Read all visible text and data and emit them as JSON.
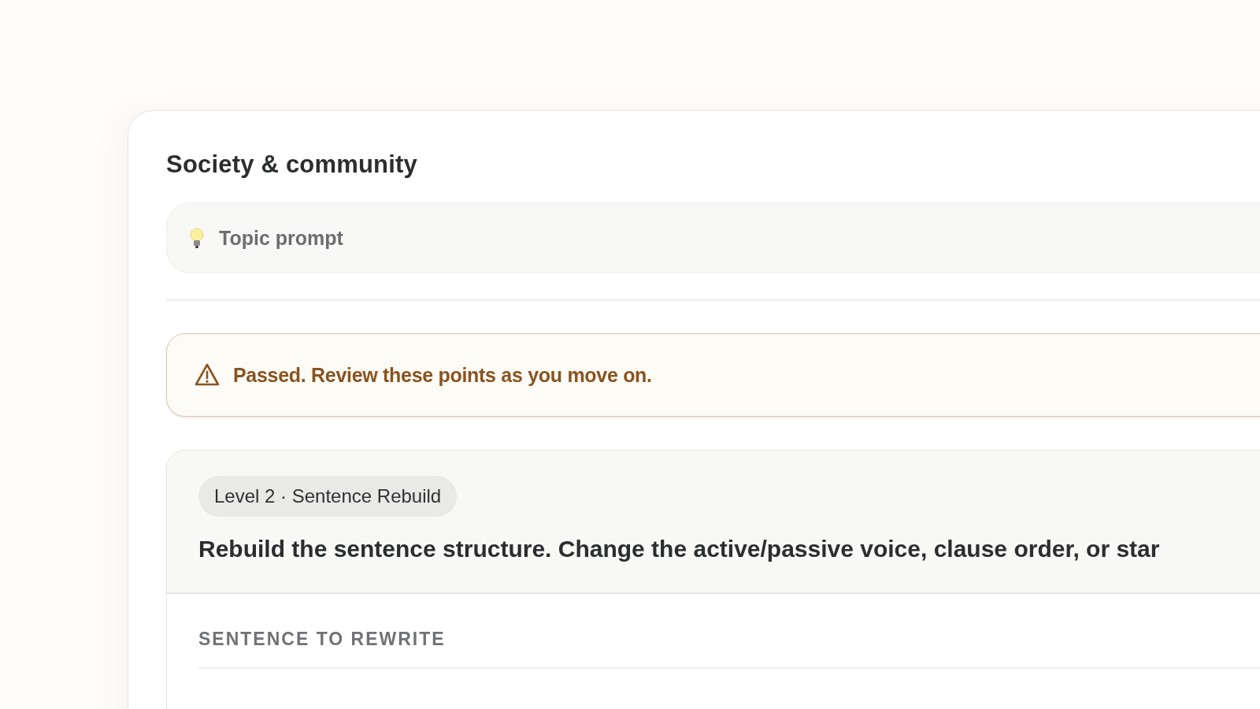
{
  "title": "Society & community",
  "topic_prompt": {
    "label": "Topic prompt"
  },
  "notice": {
    "kind": "warning",
    "text": "Passed. Review these points as you move on."
  },
  "task": {
    "badge": "Level 2 · Sentence Rebuild",
    "instruction": "Rebuild the sentence structure. Change the active/passive voice, clause order, or star",
    "section_label": "SENTENCE TO REWRITE"
  }
}
